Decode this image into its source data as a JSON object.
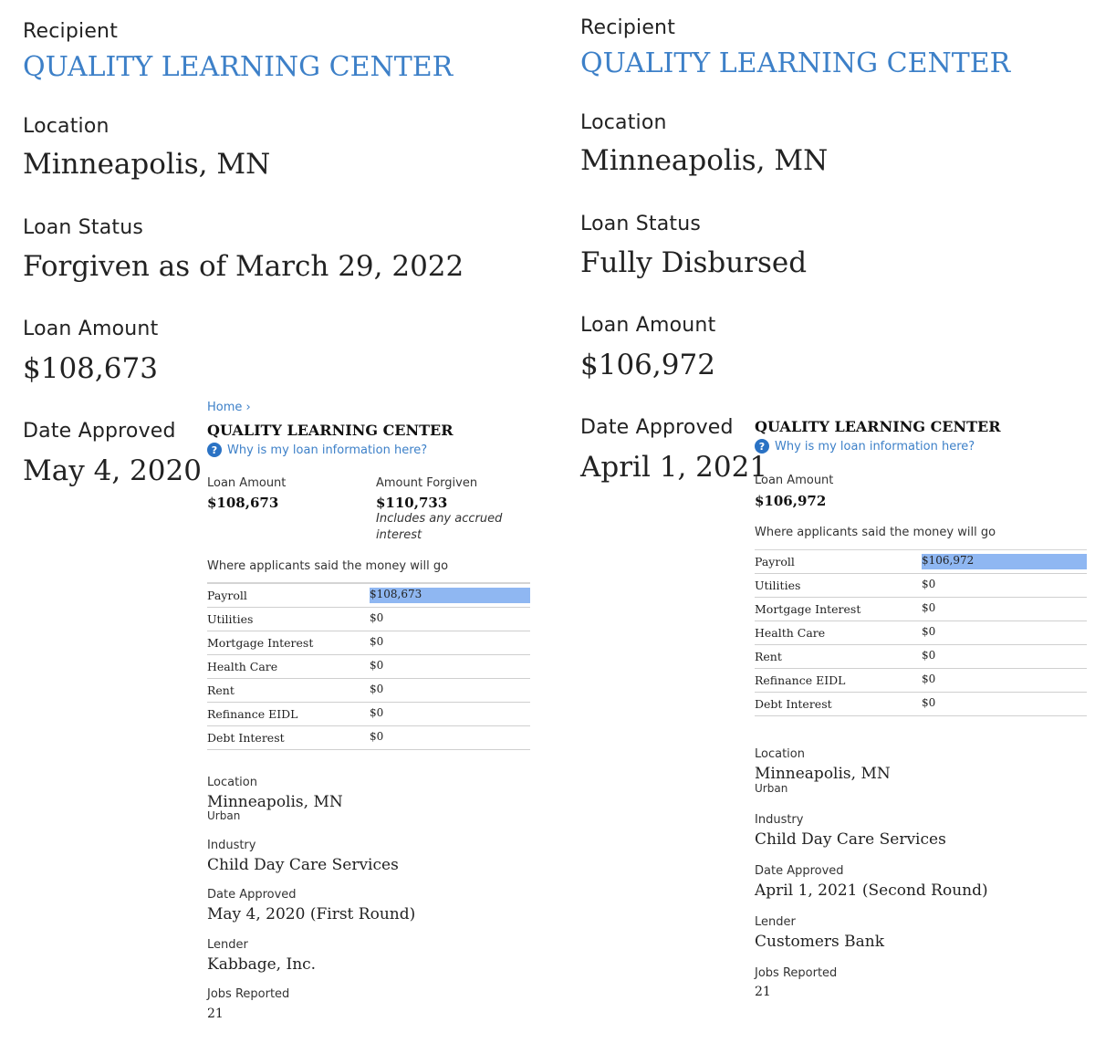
{
  "left": {
    "summary": {
      "recipient_label": "Recipient",
      "recipient_name": "QUALITY LEARNING CENTER",
      "location_label": "Location",
      "location": "Minneapolis, MN",
      "status_label": "Loan Status",
      "status": "Forgiven as of March 29, 2022",
      "amount_label": "Loan Amount",
      "amount": "$108,673",
      "date_label": "Date Approved",
      "date": "May 4, 2020"
    },
    "card": {
      "breadcrumb": "Home ›",
      "title": "QUALITY LEARNING CENTER",
      "why_link": "Why is my loan information here?",
      "loan_amount_label": "Loan Amount",
      "loan_amount": "$108,673",
      "forgiven_label": "Amount Forgiven",
      "forgiven": "$110,733",
      "forgiven_note": "Includes any accrued interest",
      "money_heading": "Where applicants said the money will go",
      "rows": [
        {
          "category": "Payroll",
          "value": "$108,673",
          "fill": 1.0
        },
        {
          "category": "Utilities",
          "value": "$0",
          "fill": 0
        },
        {
          "category": "Mortgage Interest",
          "value": "$0",
          "fill": 0
        },
        {
          "category": "Health Care",
          "value": "$0",
          "fill": 0
        },
        {
          "category": "Rent",
          "value": "$0",
          "fill": 0
        },
        {
          "category": "Refinance EIDL",
          "value": "$0",
          "fill": 0
        },
        {
          "category": "Debt Interest",
          "value": "$0",
          "fill": 0
        }
      ],
      "location_label": "Location",
      "location": "Minneapolis, MN",
      "location_type": "Urban",
      "industry_label": "Industry",
      "industry": "Child Day Care Services",
      "date_label": "Date Approved",
      "date": "May 4, 2020 (First Round)",
      "lender_label": "Lender",
      "lender": "Kabbage, Inc.",
      "jobs_label": "Jobs Reported",
      "jobs": "21"
    }
  },
  "right": {
    "summary": {
      "recipient_label": "Recipient",
      "recipient_name": "QUALITY LEARNING CENTER",
      "location_label": "Location",
      "location": "Minneapolis, MN",
      "status_label": "Loan Status",
      "status": "Fully Disbursed",
      "amount_label": "Loan Amount",
      "amount": "$106,972",
      "date_label": "Date Approved",
      "date": "April 1, 2021"
    },
    "card": {
      "title": "QUALITY LEARNING CENTER",
      "why_link": "Why is my loan information here?",
      "loan_amount_label": "Loan Amount",
      "loan_amount": "$106,972",
      "money_heading": "Where applicants said the money will go",
      "rows": [
        {
          "category": "Payroll",
          "value": "$106,972",
          "fill": 1.0
        },
        {
          "category": "Utilities",
          "value": "$0",
          "fill": 0
        },
        {
          "category": "Mortgage Interest",
          "value": "$0",
          "fill": 0
        },
        {
          "category": "Health Care",
          "value": "$0",
          "fill": 0
        },
        {
          "category": "Rent",
          "value": "$0",
          "fill": 0
        },
        {
          "category": "Refinance EIDL",
          "value": "$0",
          "fill": 0
        },
        {
          "category": "Debt Interest",
          "value": "$0",
          "fill": 0
        }
      ],
      "location_label": "Location",
      "location": "Minneapolis, MN",
      "location_type": "Urban",
      "industry_label": "Industry",
      "industry": "Child Day Care Services",
      "date_label": "Date Approved",
      "date": "April 1, 2021 (Second Round)",
      "lender_label": "Lender",
      "lender": "Customers Bank",
      "jobs_label": "Jobs Reported",
      "jobs": "21"
    }
  },
  "colors": {
    "link": "#3d80c8",
    "highlight": "#8fb7f2",
    "help_icon": "#2a72c4"
  }
}
